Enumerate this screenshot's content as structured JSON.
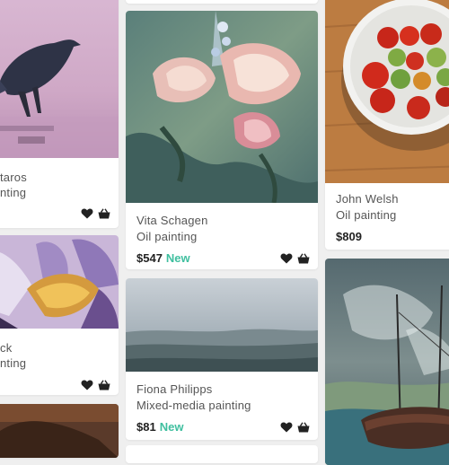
{
  "cards": [
    {
      "artist": "taros",
      "medium": "nting"
    },
    {
      "artist": "ck",
      "medium": "nting"
    },
    {
      "artist": "Vita Schagen",
      "medium": "Oil painting",
      "price": "$547",
      "badge": "New"
    },
    {
      "artist": "Fiona Philipps",
      "medium": "Mixed-media painting",
      "price": "$81",
      "badge": "New"
    },
    {
      "artist": "John Welsh",
      "medium": "Oil painting",
      "price": "$809"
    }
  ],
  "icons": {
    "favorite": "heart-icon",
    "cart": "basket-icon"
  },
  "colors": {
    "new_badge": "#3fbf9f",
    "background": "#efefef",
    "card": "#ffffff"
  }
}
